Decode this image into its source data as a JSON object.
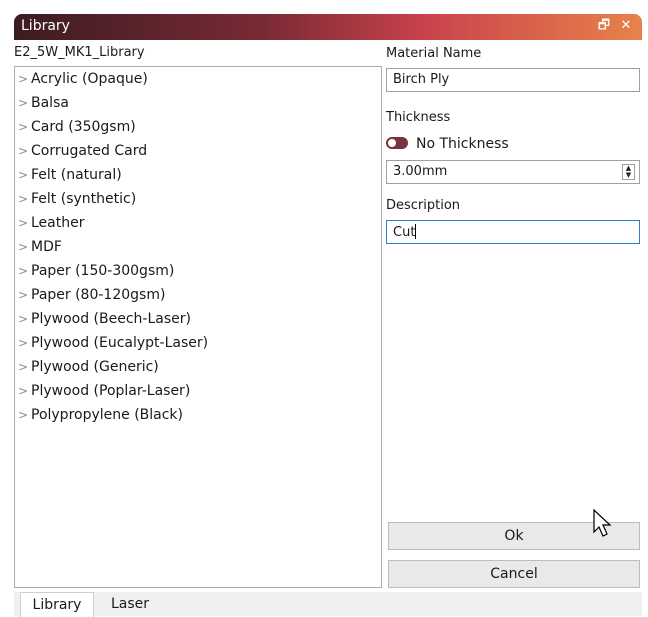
{
  "window": {
    "title": "Library",
    "float_icon": "float-window-icon",
    "close_icon": "close-icon"
  },
  "library": {
    "name": "E2_5W_MK1_Library",
    "items": [
      "Acrylic (Opaque)",
      "Balsa",
      "Card (350gsm)",
      "Corrugated Card",
      "Felt (natural)",
      "Felt (synthetic)",
      "Leather",
      "MDF",
      "Paper (150-300gsm)",
      "Paper (80-120gsm)",
      "Plywood (Beech-Laser)",
      "Plywood (Eucalypt-Laser)",
      "Plywood (Generic)",
      "Plywood (Poplar-Laser)",
      "Polypropylene (Black)"
    ]
  },
  "form": {
    "material_name_label": "Material Name",
    "material_name_value": "Birch Ply",
    "thickness_label": "Thickness",
    "no_thickness_label": "No Thickness",
    "thickness_value": "3.00mm",
    "description_label": "Description",
    "description_value": "Cut"
  },
  "buttons": {
    "ok": "Ok",
    "cancel": "Cancel"
  },
  "tabs": [
    {
      "label": "Library",
      "active": true
    },
    {
      "label": "Laser",
      "active": false
    }
  ],
  "colors": {
    "toggle": "#7a3440",
    "focus": "#2f7fd3"
  }
}
